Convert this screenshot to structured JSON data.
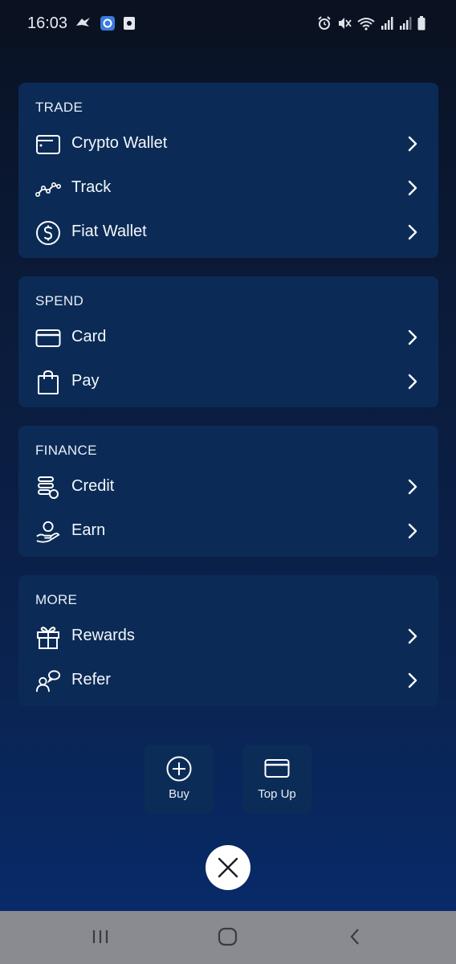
{
  "status_bar": {
    "time": "16:03",
    "left_icons": [
      "navigation-icon",
      "app-notification-icon",
      "screenshot-icon"
    ],
    "right_icons": [
      "alarm-icon",
      "mute-icon",
      "wifi-icon",
      "signal-icon",
      "signal-icon-2",
      "battery-icon"
    ]
  },
  "sections": {
    "trade": {
      "title": "TRADE",
      "items": [
        {
          "label": "Crypto Wallet",
          "icon": "wallet-icon"
        },
        {
          "label": "Track",
          "icon": "trend-line-icon"
        },
        {
          "label": "Fiat Wallet",
          "icon": "dollar-circle-icon"
        }
      ]
    },
    "spend": {
      "title": "SPEND",
      "items": [
        {
          "label": "Card",
          "icon": "credit-card-icon"
        },
        {
          "label": "Pay",
          "icon": "shopping-bag-icon"
        }
      ]
    },
    "finance": {
      "title": "FINANCE",
      "items": [
        {
          "label": "Credit",
          "icon": "coin-stack-icon"
        },
        {
          "label": "Earn",
          "icon": "hand-coin-icon"
        }
      ]
    },
    "more": {
      "title": "MORE",
      "items": [
        {
          "label": "Rewards",
          "icon": "gift-icon"
        },
        {
          "label": "Refer",
          "icon": "refer-user-icon"
        }
      ]
    }
  },
  "actions": {
    "buy_label": "Buy",
    "topup_label": "Top Up"
  },
  "colors": {
    "card_bg": "#0b2b56",
    "status_bar_bg": "#0a1120",
    "nav_bar_bg": "#8a8b90",
    "text": "#ffffff"
  }
}
